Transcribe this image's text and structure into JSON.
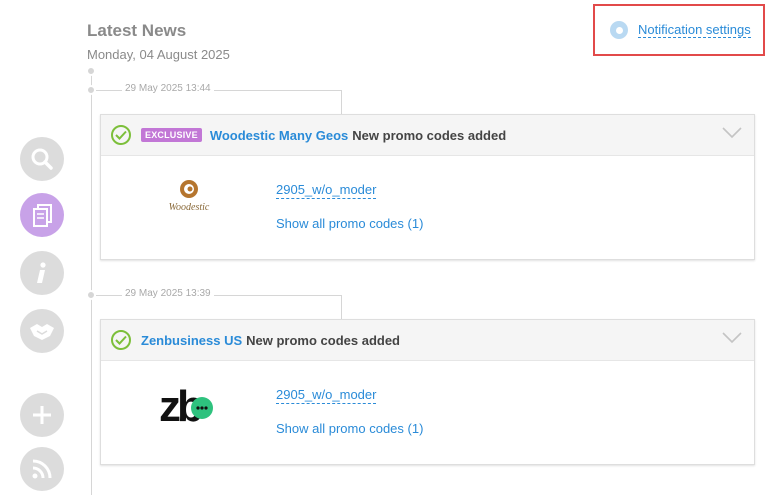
{
  "header": {
    "title": "Latest News",
    "date": "Monday, 04 August 2025"
  },
  "notification": {
    "label": "Notification settings"
  },
  "sidebar": {
    "icons": [
      "search-icon",
      "documents-icon",
      "info-icon",
      "handshake-icon",
      "plus-icon",
      "rss-icon"
    ],
    "active": "documents-icon"
  },
  "timeline": [
    {
      "stamp": "29 May 2025 13:44",
      "badge": "EXCLUSIVE",
      "brand": "Woodestic Many Geos",
      "headline": "New promo codes added",
      "logo_text": "Woodestic",
      "code": "2905_w/o_moder",
      "show_all": "Show all promo codes (1)"
    },
    {
      "stamp": "29 May 2025 13:39",
      "badge": "",
      "brand": "Zenbusiness US",
      "headline": "New promo codes added",
      "logo_text": "zb",
      "code": "2905_w/o_moder",
      "show_all": "Show all promo codes (1)"
    }
  ],
  "colors": {
    "accent": "#2a8bd8",
    "badge": "#c277d6",
    "check": "#7cbf3a",
    "highlight_border": "#e24a4a"
  }
}
